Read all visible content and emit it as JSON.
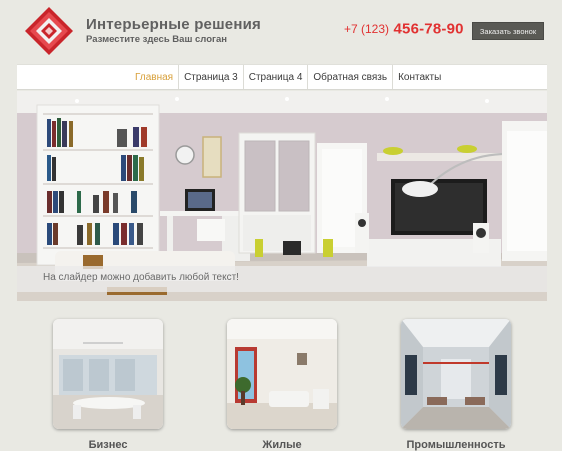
{
  "header": {
    "title": "Интерьерные решения",
    "slogan": "Разместите здесь Ваш слоган",
    "phone_code": "+7 (123)",
    "phone_number": "456-78-90",
    "callback_label": "Заказать звонок"
  },
  "nav": {
    "items": [
      {
        "label": "Главная",
        "active": true
      },
      {
        "label": "Страница 3"
      },
      {
        "label": "Страница 4"
      },
      {
        "label": "Обратная связь"
      },
      {
        "label": "Контакты"
      }
    ]
  },
  "slider": {
    "caption": "На слайдер можно добавить любой текст!"
  },
  "categories": [
    {
      "label": "Бизнес"
    },
    {
      "label": "Жилые"
    },
    {
      "label": "Промышленность"
    }
  ],
  "colors": {
    "background": "#e9e9e3",
    "accent_red": "#e13131",
    "nav_active": "#d8a03a",
    "logo_red": "#c9252b",
    "button_bg": "#5a5a55"
  }
}
